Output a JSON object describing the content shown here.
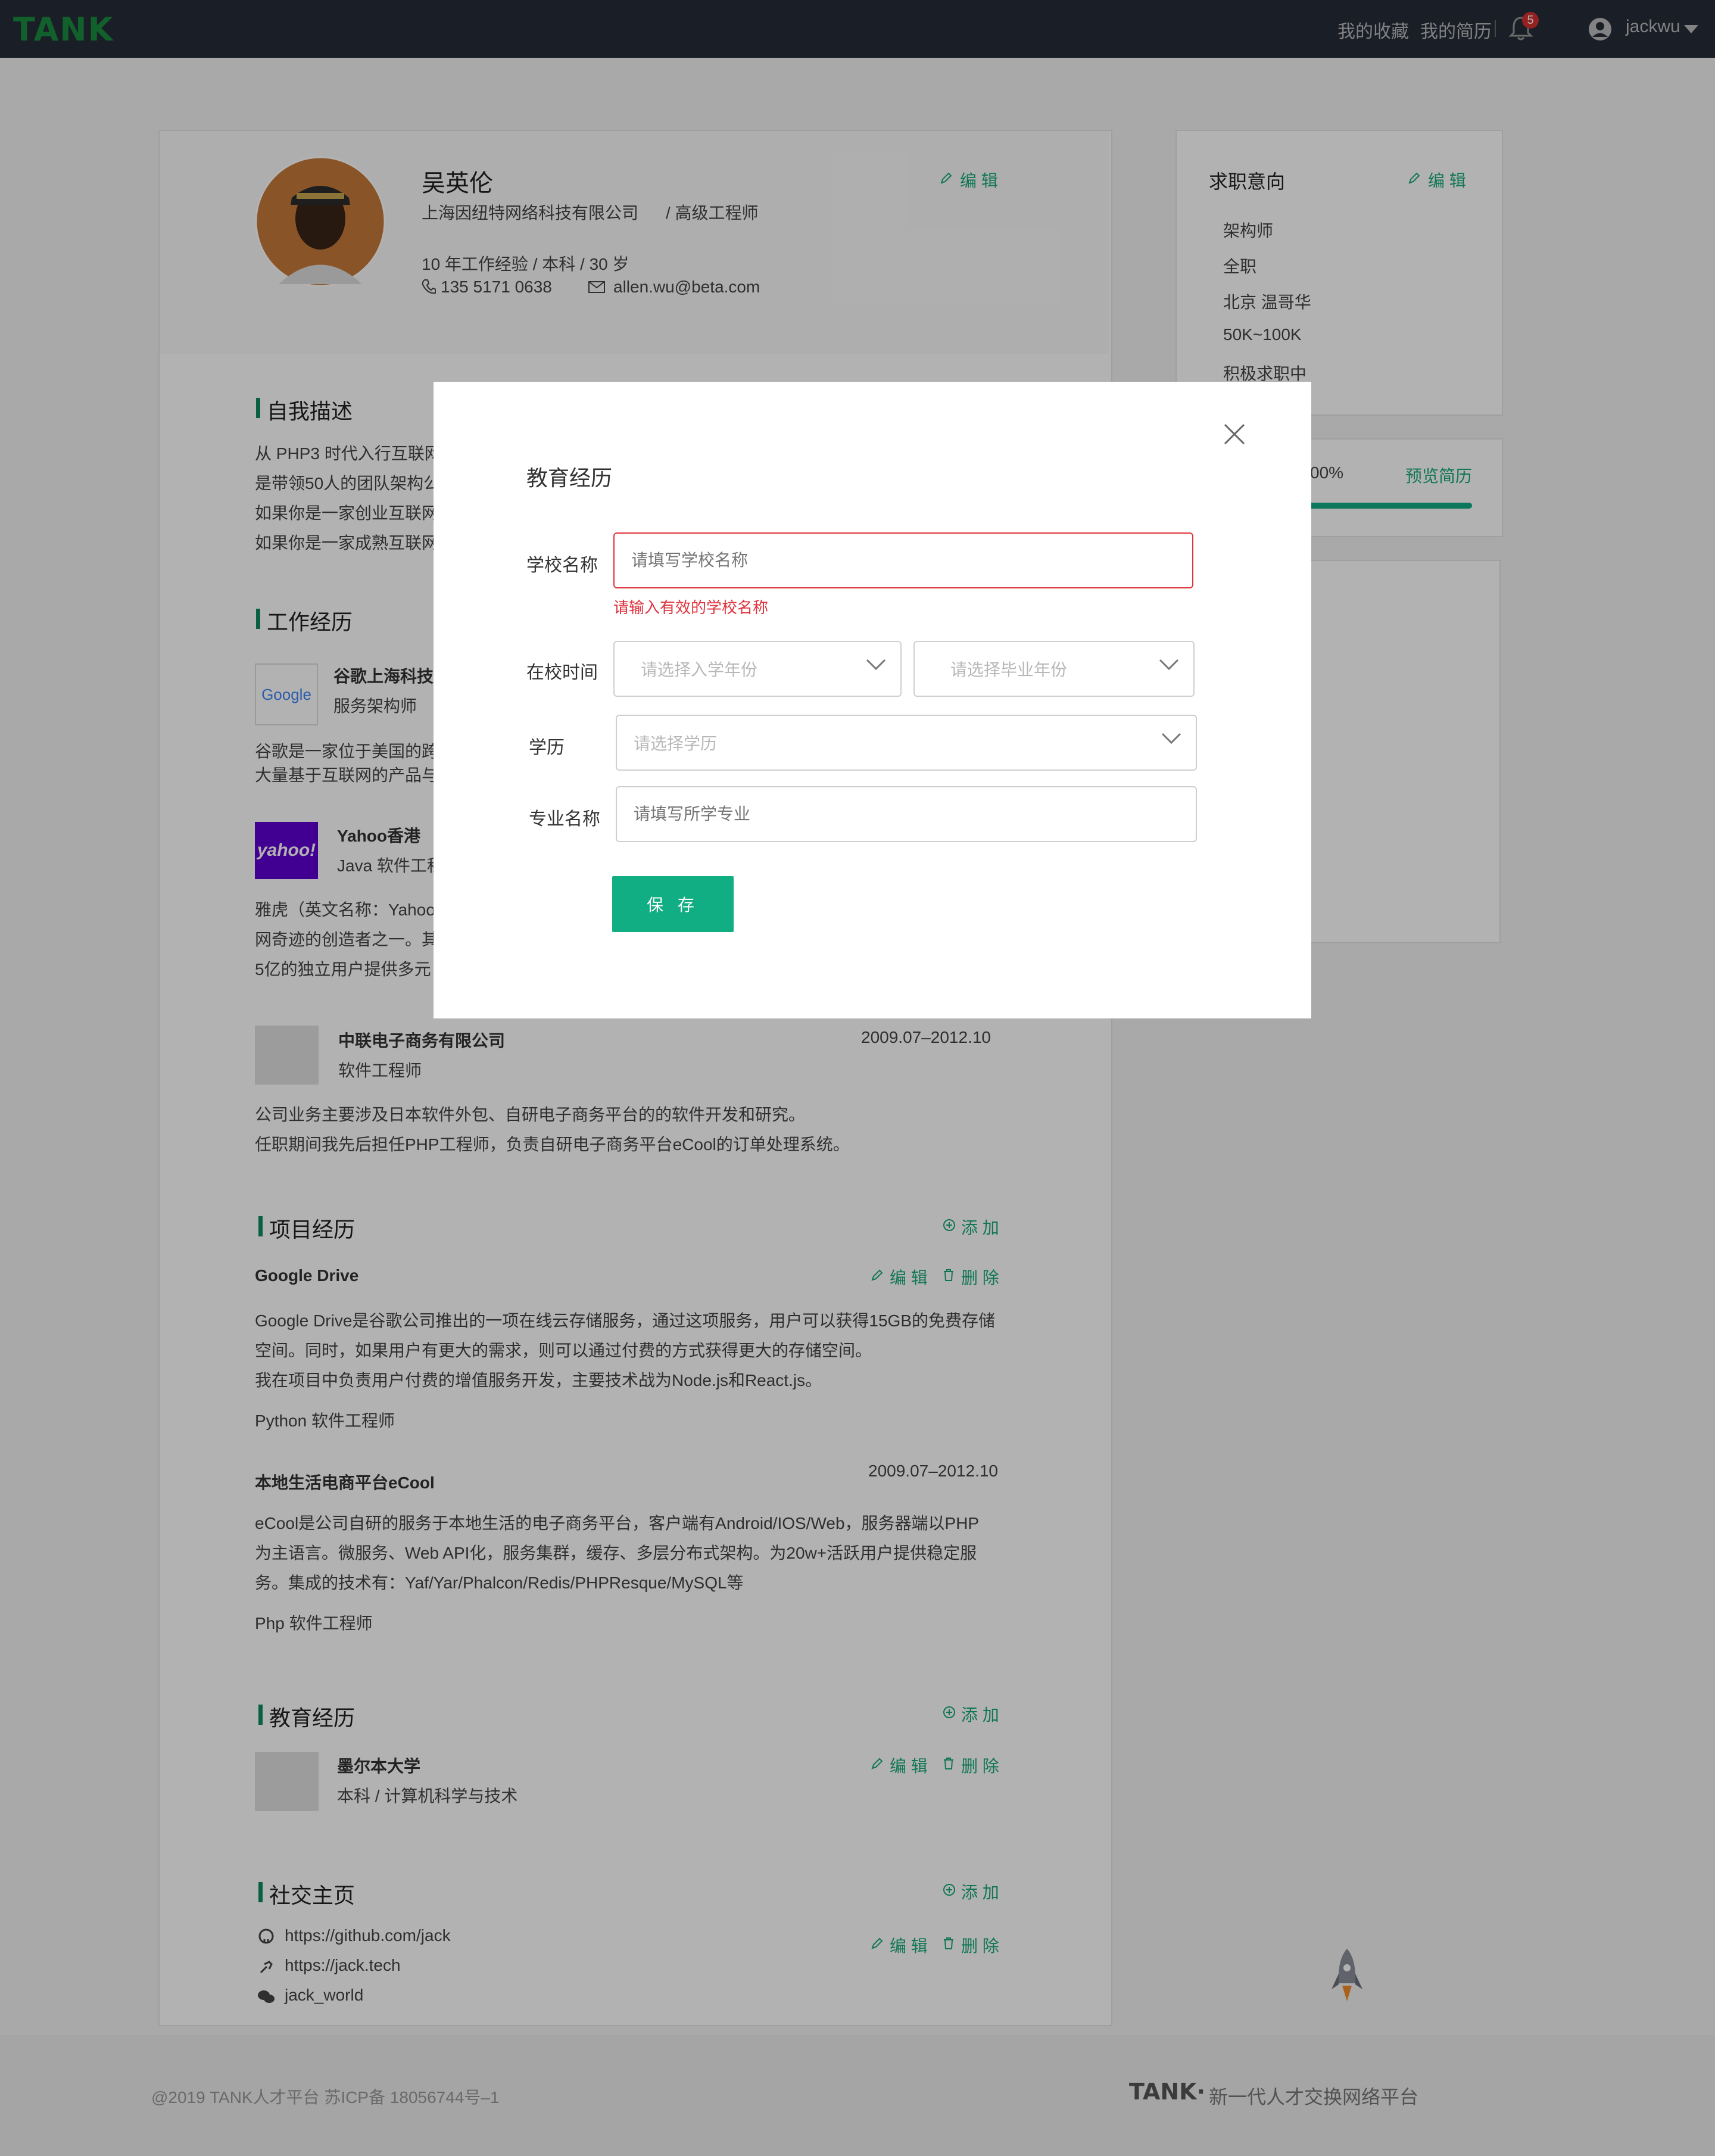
{
  "header": {
    "logo": "TANK",
    "nav_favorites": "我的收藏",
    "nav_resume": "我的简历",
    "notification_count": "5",
    "username": "jackwu"
  },
  "profile": {
    "name": "吴英伦",
    "company": "上海因纽特网络科技有限公司",
    "title": "/ 高级工程师",
    "summary": "10 年工作经验 / 本科 / 30 岁",
    "phone": "135 5171 0638",
    "email": "allen.wu@beta.com",
    "edit_label": "编 辑"
  },
  "self_desc": {
    "title": "自我描述",
    "lines": [
      "从 PHP3 时代入行互联网",
      "是带领50人的团队架构公",
      "如果你是一家创业互联网",
      "如果你是一家成熟互联网"
    ]
  },
  "work": {
    "title": "工作经历",
    "items": [
      {
        "logo": "Google",
        "company": "谷歌上海科技",
        "role": "服务架构师",
        "desc1": "谷歌是一家位于美国的跨",
        "desc2": "大量基于互联网的产品与"
      },
      {
        "logo": "yahoo!",
        "company": "Yahoo香港",
        "role": "Java 软件工程",
        "desc1": "雅虎（英文名称：Yahoo",
        "desc2": "网奇迹的创造者之一。其",
        "desc3": "5亿的独立用户提供多元"
      },
      {
        "company": "中联电子商务有限公司",
        "role": "软件工程师",
        "period": "2009.07–2012.10",
        "desc1": "公司业务主要涉及日本软件外包、自研电子商务平台的的软件开发和研究。",
        "desc2": "任职期间我先后担任PHP工程师，负责自研电子商务平台eCool的订单处理系统。"
      }
    ]
  },
  "projects": {
    "title": "项目经历",
    "add_label": "添 加",
    "edit_label": "编 辑",
    "delete_label": "删 除",
    "items": [
      {
        "name": "Google Drive",
        "d1": "Google Drive是谷歌公司推出的一项在线云存储服务，通过这项服务，用户可以获得15GB的免费存储",
        "d2": "空间。同时，如果用户有更大的需求，则可以通过付费的方式获得更大的存储空间。",
        "d3": "我在项目中负责用户付费的增值服务开发，主要技术战为Node.js和React.js。",
        "role": "Python 软件工程师"
      },
      {
        "name": "本地生活电商平台eCool",
        "period": "2009.07–2012.10",
        "d1": "eCool是公司自研的服务于本地生活的电子商务平台，客户端有Android/IOS/Web，服务器端以PHP",
        "d2": "为主语言。微服务、Web API化，服务集群，缓存、多层分布式架构。为20w+活跃用户提供稳定服",
        "d3": "务。集成的技术有：Yaf/Yar/Phalcon/Redis/PHPResque/MySQL等",
        "role": "Php 软件工程师"
      }
    ]
  },
  "education": {
    "title": "教育经历",
    "school": "墨尔本大学",
    "degree": "本科 / 计算机科学与技术"
  },
  "social": {
    "title": "社交主页",
    "github": "https://github.com/jack",
    "site": "https://jack.tech",
    "wechat": "jack_world"
  },
  "intent": {
    "title": "求职意向",
    "edit_label": "编 辑",
    "items": [
      "架构师",
      "全职",
      "北京 温哥华",
      "50K~100K",
      "积极求职中"
    ],
    "progress_text": "00%",
    "progress_value": 1.0,
    "preview_label": "预览简历"
  },
  "footer": {
    "copyright": "@2019 TANK人才平台 苏ICP备 18056744号–1",
    "brand": "TANK·",
    "slogan": "新一代人才交换网络平台"
  },
  "modal": {
    "title": "教育经历",
    "school_label": "学校名称",
    "school_placeholder": "请填写学校名称",
    "school_error": "请输入有效的学校名称",
    "time_label": "在校时间",
    "start_placeholder": "请选择入学年份",
    "end_placeholder": "请选择毕业年份",
    "degree_label": "学历",
    "degree_placeholder": "请选择学历",
    "major_label": "专业名称",
    "major_placeholder": "请填写所学专业",
    "save_label": "保 存"
  }
}
